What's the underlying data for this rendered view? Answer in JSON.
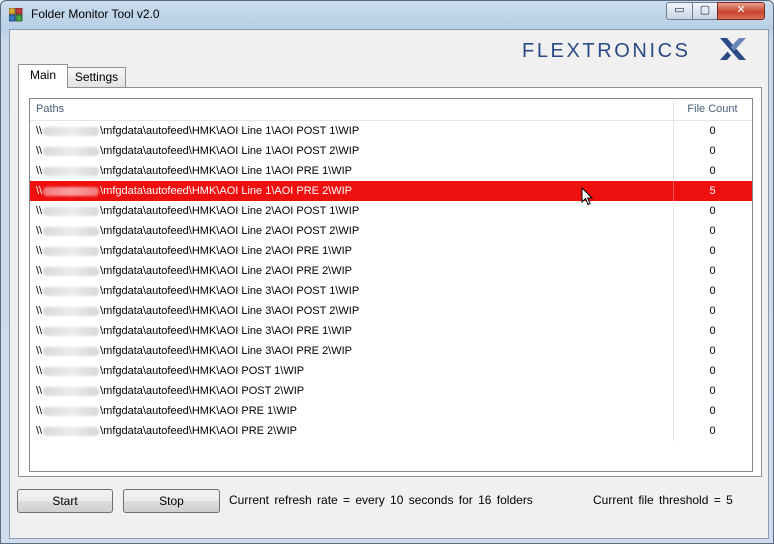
{
  "window": {
    "title": "Folder Monitor Tool v2.0",
    "min_symbol": "▭",
    "max_symbol": "▢",
    "close_symbol": "✕"
  },
  "logo": {
    "text": "FLEXTRONICS",
    "mark": "X"
  },
  "tabs": [
    {
      "label": "Main",
      "selected": true
    },
    {
      "label": "Settings",
      "selected": false
    }
  ],
  "list": {
    "columns": {
      "paths": "Paths",
      "file_count": "File Count"
    },
    "rows": [
      {
        "prefix": "\\\\",
        "path": "\\mfgdata\\autofeed\\HMK\\AOI Line 1\\AOI POST 1\\WIP",
        "count": "0"
      },
      {
        "prefix": "\\\\",
        "path": "\\mfgdata\\autofeed\\HMK\\AOI Line 1\\AOI POST 2\\WIP",
        "count": "0"
      },
      {
        "prefix": "\\\\",
        "path": "\\mfgdata\\autofeed\\HMK\\AOI Line 1\\AOI PRE 1\\WIP",
        "count": "0"
      },
      {
        "prefix": "\\\\",
        "path": "\\mfgdata\\autofeed\\HMK\\AOI Line 1\\AOI PRE 2\\WIP",
        "count": "5",
        "highlight": true
      },
      {
        "prefix": "\\\\",
        "path": "\\mfgdata\\autofeed\\HMK\\AOI Line 2\\AOI POST 1\\WIP",
        "count": "0"
      },
      {
        "prefix": "\\\\",
        "path": "\\mfgdata\\autofeed\\HMK\\AOI Line 2\\AOI POST 2\\WIP",
        "count": "0"
      },
      {
        "prefix": "\\\\",
        "path": "\\mfgdata\\autofeed\\HMK\\AOI Line 2\\AOI PRE 1\\WIP",
        "count": "0"
      },
      {
        "prefix": "\\\\",
        "path": "\\mfgdata\\autofeed\\HMK\\AOI Line 2\\AOI PRE 2\\WIP",
        "count": "0"
      },
      {
        "prefix": "\\\\",
        "path": "\\mfgdata\\autofeed\\HMK\\AOI Line 3\\AOI POST 1\\WIP",
        "count": "0"
      },
      {
        "prefix": "\\\\",
        "path": "\\mfgdata\\autofeed\\HMK\\AOI Line 3\\AOI POST 2\\WIP",
        "count": "0"
      },
      {
        "prefix": "\\\\",
        "path": "\\mfgdata\\autofeed\\HMK\\AOI Line 3\\AOI PRE 1\\WIP",
        "count": "0"
      },
      {
        "prefix": "\\\\",
        "path": "\\mfgdata\\autofeed\\HMK\\AOI Line 3\\AOI PRE 2\\WIP",
        "count": "0"
      },
      {
        "prefix": "\\\\",
        "path": "\\mfgdata\\autofeed\\HMK\\AOI POST 1\\WIP",
        "count": "0"
      },
      {
        "prefix": "\\\\",
        "path": "\\mfgdata\\autofeed\\HMK\\AOI POST 2\\WIP",
        "count": "0"
      },
      {
        "prefix": "\\\\",
        "path": "\\mfgdata\\autofeed\\HMK\\AOI PRE 1\\WIP",
        "count": "0"
      },
      {
        "prefix": "\\\\",
        "path": "\\mfgdata\\autofeed\\HMK\\AOI PRE 2\\WIP",
        "count": "0"
      }
    ]
  },
  "controls": {
    "start_label": "Start",
    "stop_label": "Stop",
    "refresh_status": "Current refresh rate = every 10 seconds for 16 folders",
    "threshold_status": "Current file threshold = 5"
  },
  "colors": {
    "highlight_row": "#ee0f0f",
    "logo_blue": "#2a4a86"
  }
}
